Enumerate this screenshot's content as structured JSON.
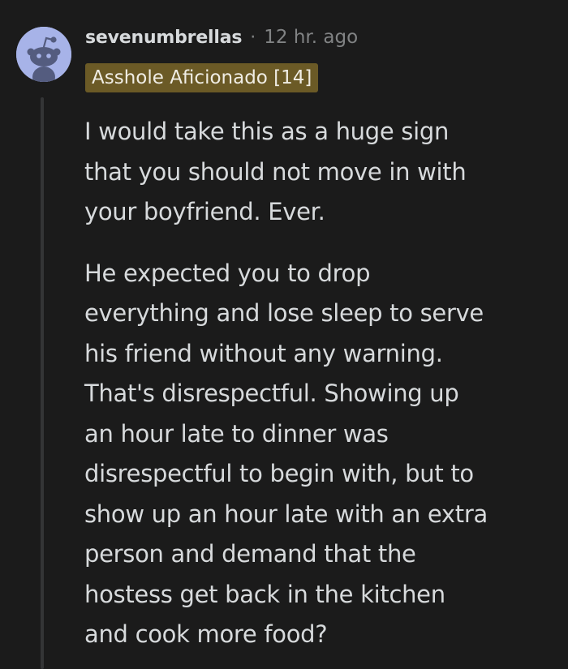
{
  "comment": {
    "author": "sevenumbrellas",
    "separator": "·",
    "timestamp": "12 hr. ago",
    "flair": "Asshole Aficionado [14]",
    "avatar_icon": "snoo-avatar-icon",
    "paragraphs": [
      {
        "lines": [
          "I would take this as a huge sign",
          "that you should not move in with",
          "your boyfriend. Ever."
        ]
      },
      {
        "lines": [
          "He expected you to drop",
          "everything and lose sleep to serve",
          "his friend without any warning.",
          "That's disrespectful. Showing up",
          "an hour late to dinner was",
          "disrespectful to begin with, but to",
          "show up an hour late with an extra",
          "person and demand that the",
          "hostess get back in the kitchen",
          "and cook more food?"
        ]
      }
    ]
  },
  "colors": {
    "background": "#1b1b1b",
    "text": "#d7dadc",
    "muted": "#818384",
    "flair_bg": "#6b5a26",
    "avatar_bg": "#a7b3e8"
  }
}
